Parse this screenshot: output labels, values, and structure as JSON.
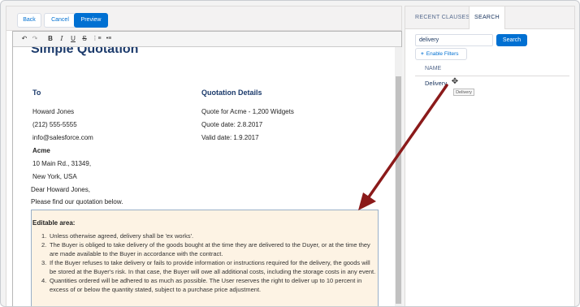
{
  "editor": {
    "buttons": {
      "back": "Back",
      "cancel": "Cancel",
      "preview": "Preview"
    },
    "toolbar": {
      "undo": "↶",
      "redo": "↷",
      "bold": "B",
      "italic": "I",
      "underline": "U",
      "strike": "S",
      "ordered_list": "⋮≡",
      "bullet_list": "•≡"
    },
    "document": {
      "title": "Simple Quotation",
      "to_heading": "To",
      "details_heading": "Quotation Details",
      "to_lines": [
        "Howard Jones",
        "(212) 555-5555",
        "info@salesforce.com"
      ],
      "company": "Acme",
      "address_lines": [
        "10 Main Rd., 31349,",
        "New York, USA"
      ],
      "details_lines": [
        "Quote for Acme - 1,200 Widgets",
        "Quote date: 2.8.2017",
        "Valid date: 1.9.2017"
      ],
      "greeting": "Dear Howard Jones,",
      "intro": "Please find our quotation below."
    },
    "editable_area": {
      "heading": "Editable area:",
      "items": [
        {
          "num": "1.",
          "text": "Unless otherwise agreed, delivery shall be 'ex works'."
        },
        {
          "num": "2.",
          "text": "The Buyer is obliged to take delivery of the goods bought at the time they are delivered to the Duyer, or at the time they are made available to the Buyer in accordance with the contract."
        },
        {
          "num": "3.",
          "text": "If the Buyer refuses to take delivery or fails to provide information or instructions required for the delivery, the goods will be stored at the Buyer's risk. In that case, the Buyer will owe all additional costs, including the storage costs in any event."
        },
        {
          "num": "4.",
          "text": "Quantities ordered will be adhered to as much as possible. The User reserves the right to deliver up to 10 percent in excess of or below the quantity stated, subject to a purchase price adjustment."
        }
      ]
    }
  },
  "sidebar": {
    "tabs": {
      "recent": "RECENT CLAUSES",
      "search": "SEARCH"
    },
    "search_value": "delivery",
    "search_button": "Search",
    "filters_button": "Enable Filters",
    "column_header": "NAME",
    "results": [
      "Delivery"
    ],
    "tooltip": "Delivery"
  },
  "colors": {
    "brand_blue": "#0070d2",
    "editable_bg": "#fdf3e4",
    "arrow": "#8b1a1a"
  },
  "icons": {
    "move": "move-cursor-icon",
    "plus": "plus-icon"
  }
}
